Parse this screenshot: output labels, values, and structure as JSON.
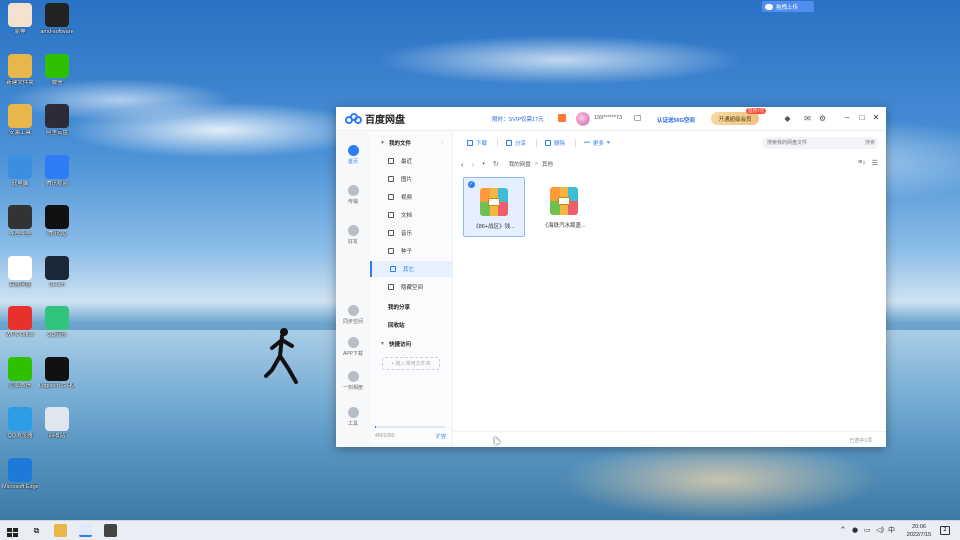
{
  "desktop": {
    "icons": [
      {
        "label": "原神",
        "color": "#f4e2d0"
      },
      {
        "label": "amd-software",
        "color": "#222222"
      },
      {
        "label": "新建文件夹",
        "color": "#e8b64a"
      },
      {
        "label": "微信",
        "color": "#2dc100"
      },
      {
        "label": "安装工具",
        "color": "#e8b64a"
      },
      {
        "label": "阿里云盘",
        "color": "#2b2b3a"
      },
      {
        "label": "此电脑",
        "color": "#3b8fe0"
      },
      {
        "label": "腾讯视频",
        "color": "#2f7cf6"
      },
      {
        "label": "哔哩哔哩",
        "color": "#333333"
      },
      {
        "label": "腾讯QQ",
        "color": "#111111"
      },
      {
        "label": "百度网盘",
        "color": "#ffffff"
      },
      {
        "label": "Steam",
        "color": "#1b2838"
      },
      {
        "label": "WPS Office",
        "color": "#e8312c"
      },
      {
        "label": "QQ音乐",
        "color": "#31c27c"
      },
      {
        "label": "企业微信",
        "color": "#2dc100"
      },
      {
        "label": "Logitech G HUB",
        "color": "#111111"
      },
      {
        "label": "QQ浏览器",
        "color": "#2f9ce8"
      },
      {
        "label": "回收站",
        "color": "#e0e6ef"
      },
      {
        "label": "Microsoft Edge",
        "color": "#1e7ad9"
      }
    ]
  },
  "float_widget": {
    "label": "拖拽上传"
  },
  "app": {
    "title": "百度网盘",
    "promo": "限时：SVIP仅需17元",
    "account": "199******73",
    "verify": "认证送50G空间",
    "vip_button": "开通超级会员",
    "vip_tag": "首月7元",
    "rail": [
      {
        "label": "首页",
        "active": true
      },
      {
        "label": "传输",
        "active": false
      },
      {
        "label": "好友",
        "active": false
      },
      {
        "label": "同步空间",
        "active": false
      },
      {
        "label": "APP下载",
        "active": false
      },
      {
        "label": "一刻相册",
        "active": false
      },
      {
        "label": "工具",
        "active": false
      }
    ],
    "sidebar": {
      "my_files": "我的文件",
      "more": "⋮",
      "items": [
        {
          "label": "最近",
          "selected": false
        },
        {
          "label": "图片",
          "selected": false
        },
        {
          "label": "视频",
          "selected": false
        },
        {
          "label": "文档",
          "selected": false
        },
        {
          "label": "音乐",
          "selected": false
        },
        {
          "label": "种子",
          "selected": false
        },
        {
          "label": "其它",
          "selected": true
        },
        {
          "label": "隐藏空间",
          "selected": false
        }
      ],
      "my_share": "我的分享",
      "recycle": "回收站",
      "quick_access": "快捷访问",
      "add_quick": "+ 拖入常用文件夹",
      "storage_text": "4M/1050",
      "storage_fraction": 0.02,
      "expand": "扩容"
    },
    "toolbar": {
      "download": "下载",
      "share": "分享",
      "delete": "删除",
      "more": "更多",
      "search_placeholder": "搜索我的网盘文件",
      "search_btn": "搜索"
    },
    "breadcrumb": {
      "root": "我的网盘",
      "sep": ">",
      "current": "其他"
    },
    "files": [
      {
        "name": "《86+战区》钱...",
        "selected": true
      },
      {
        "name": "《海铁汽水瓶盖...",
        "selected": false
      }
    ],
    "status": "已选中1项"
  },
  "taskbar": {
    "time": "20:06",
    "date": "2022/7/15",
    "ime": "中",
    "notify_count": "2"
  }
}
